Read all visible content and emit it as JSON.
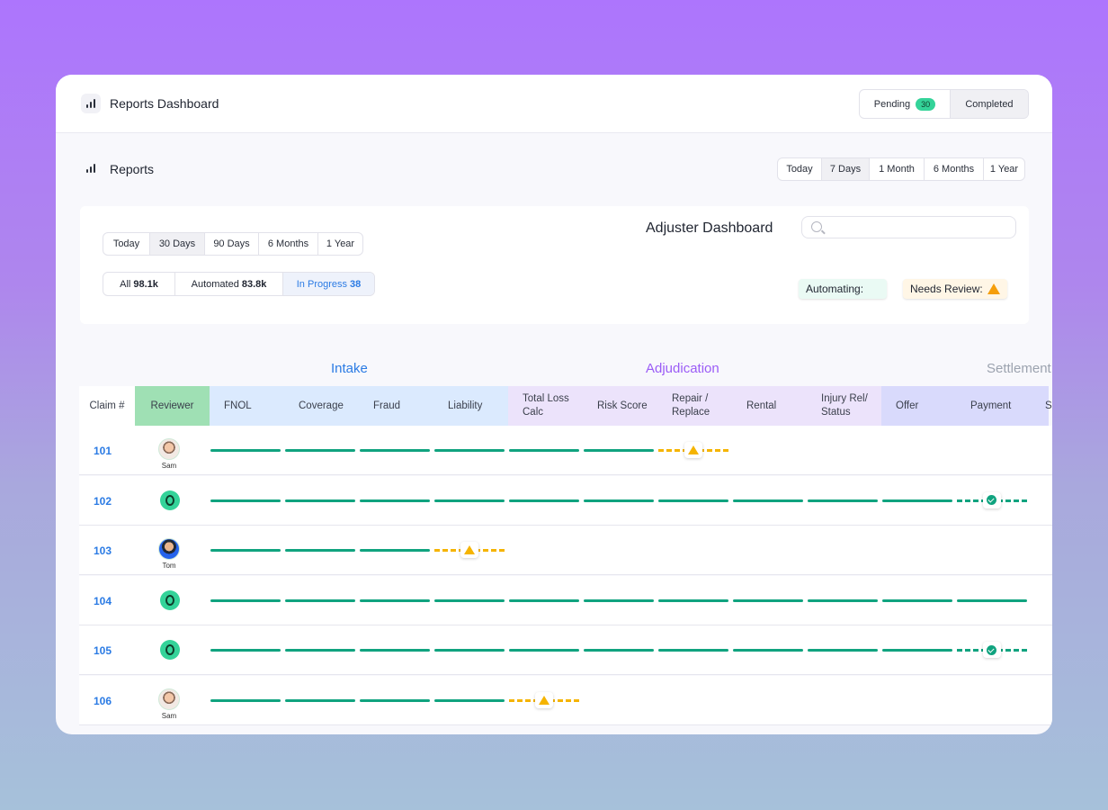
{
  "app": {
    "title": "Reports Dashboard"
  },
  "status_toggle": {
    "pending_label": "Pending",
    "pending_count": "30",
    "completed_label": "Completed"
  },
  "reports": {
    "title": "Reports",
    "ranges": [
      "Today",
      "7 Days",
      "1 Month",
      "6 Months",
      "1 Year"
    ],
    "selected_range": "7 Days"
  },
  "adjuster": {
    "title": "Adjuster Dashboard",
    "search_placeholder": "",
    "ranges": [
      "Today",
      "30 Days",
      "90 Days",
      "6 Months",
      "1 Year"
    ],
    "selected_range": "30 Days",
    "counts": [
      {
        "label": "All",
        "value": "98.1k"
      },
      {
        "label": "Automated",
        "value": "83.8k"
      },
      {
        "label": "In Progress",
        "value": "38"
      }
    ],
    "legend": {
      "automating": "Automating:",
      "needs_review": "Needs Review:"
    }
  },
  "groups": [
    {
      "label": "Intake",
      "color": "#2b7be4"
    },
    {
      "label": "Adjudication",
      "color": "#9b5cf6"
    },
    {
      "label": "Settlement",
      "color": "#9ca3af"
    }
  ],
  "columns": {
    "claim": "Claim #",
    "reviewer": "Reviewer",
    "stages": [
      "FNOL",
      "Coverage",
      "Fraud",
      "Liability",
      "Total Loss Calc",
      "Risk Score",
      "Repair / Replace",
      "Rental",
      "Injury Rel/ Status",
      "Offer",
      "Payment",
      "S"
    ]
  },
  "colors": {
    "reviewer_header": "#9fe0b4",
    "intake_header": "#dbeafe",
    "adjudication_header": "#ece3fb",
    "settlement_header": "#d9dafc",
    "complete_line": "#10a37f",
    "review_line": "#f5b400",
    "link": "#2b7be4"
  },
  "rows": [
    {
      "claim": "101",
      "reviewer": {
        "type": "person",
        "name": "Sam"
      },
      "completed": 6,
      "flag": {
        "type": "review",
        "stage": 7
      }
    },
    {
      "claim": "102",
      "reviewer": {
        "type": "bot",
        "name": ""
      },
      "completed": 10,
      "flag": {
        "type": "done",
        "stage": 11
      }
    },
    {
      "claim": "103",
      "reviewer": {
        "type": "person",
        "name": "Tom"
      },
      "completed": 3,
      "flag": {
        "type": "review",
        "stage": 4
      }
    },
    {
      "claim": "104",
      "reviewer": {
        "type": "bot",
        "name": ""
      },
      "completed": 11,
      "flag": null
    },
    {
      "claim": "105",
      "reviewer": {
        "type": "bot",
        "name": ""
      },
      "completed": 10,
      "flag": {
        "type": "done",
        "stage": 11
      }
    },
    {
      "claim": "106",
      "reviewer": {
        "type": "person",
        "name": "Sam"
      },
      "completed": 4,
      "flag": {
        "type": "review",
        "stage": 5
      }
    }
  ]
}
